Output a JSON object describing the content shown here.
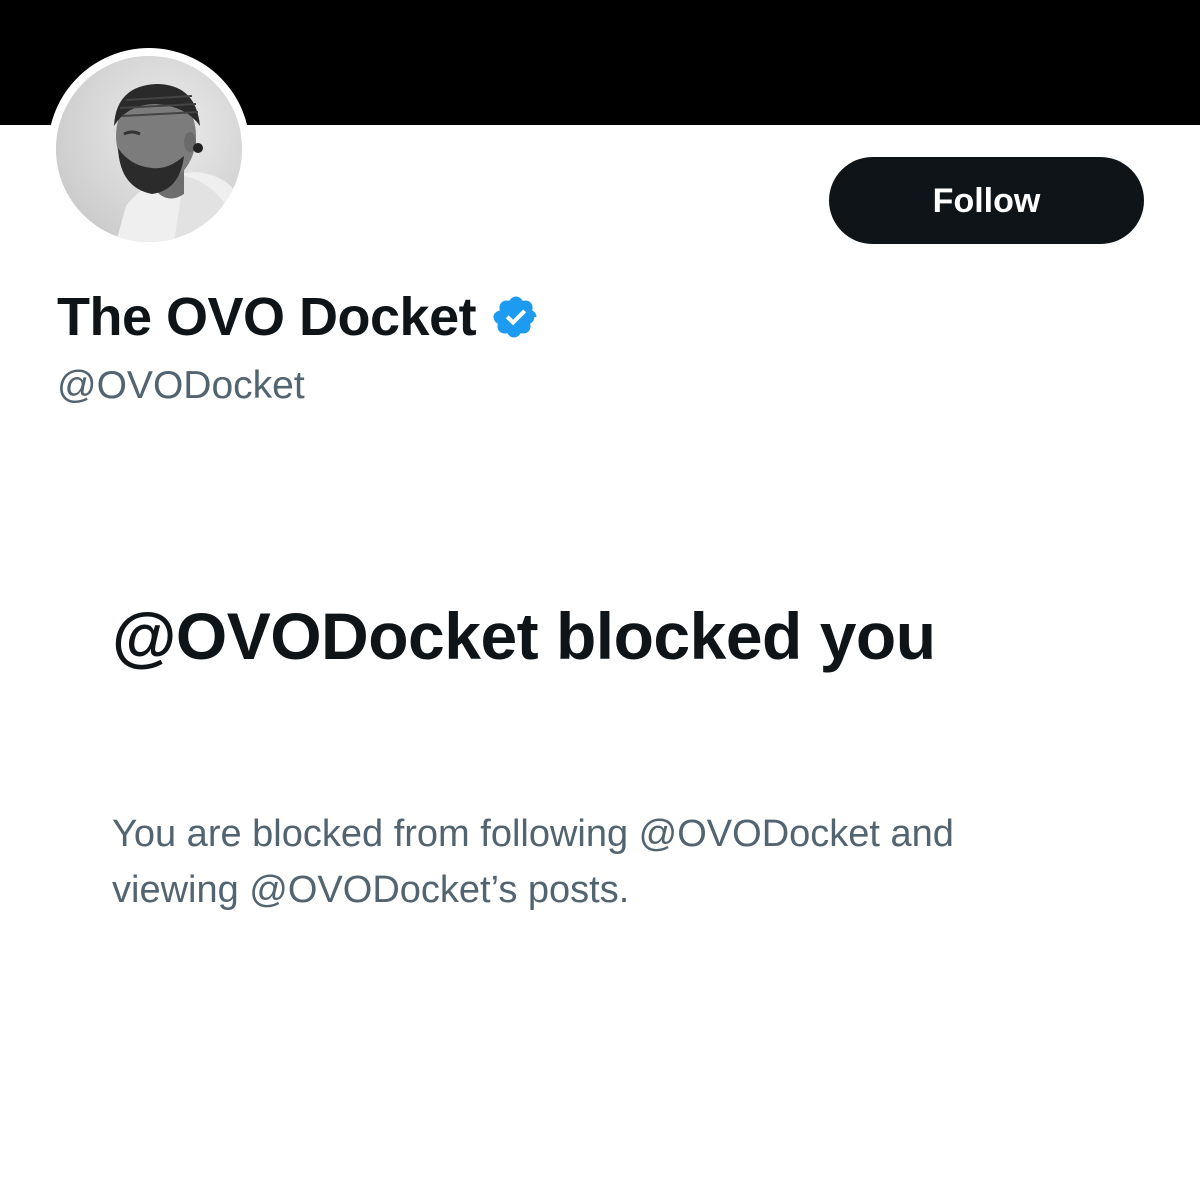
{
  "profile": {
    "display_name": "The OVO Docket",
    "handle": "@OVODocket",
    "verified": true,
    "verified_icon": "verified-badge-icon",
    "verified_color": "#1d9bf0"
  },
  "actions": {
    "follow_label": "Follow"
  },
  "blocked_notice": {
    "title": "@OVODocket blocked you",
    "description": "You are blocked from following @OVODocket and viewing @OVODocket’s posts."
  },
  "colors": {
    "banner": "#000000",
    "primary_text": "#0f1419",
    "secondary_text": "#536471",
    "button_bg": "#0f1419",
    "button_text": "#ffffff"
  }
}
